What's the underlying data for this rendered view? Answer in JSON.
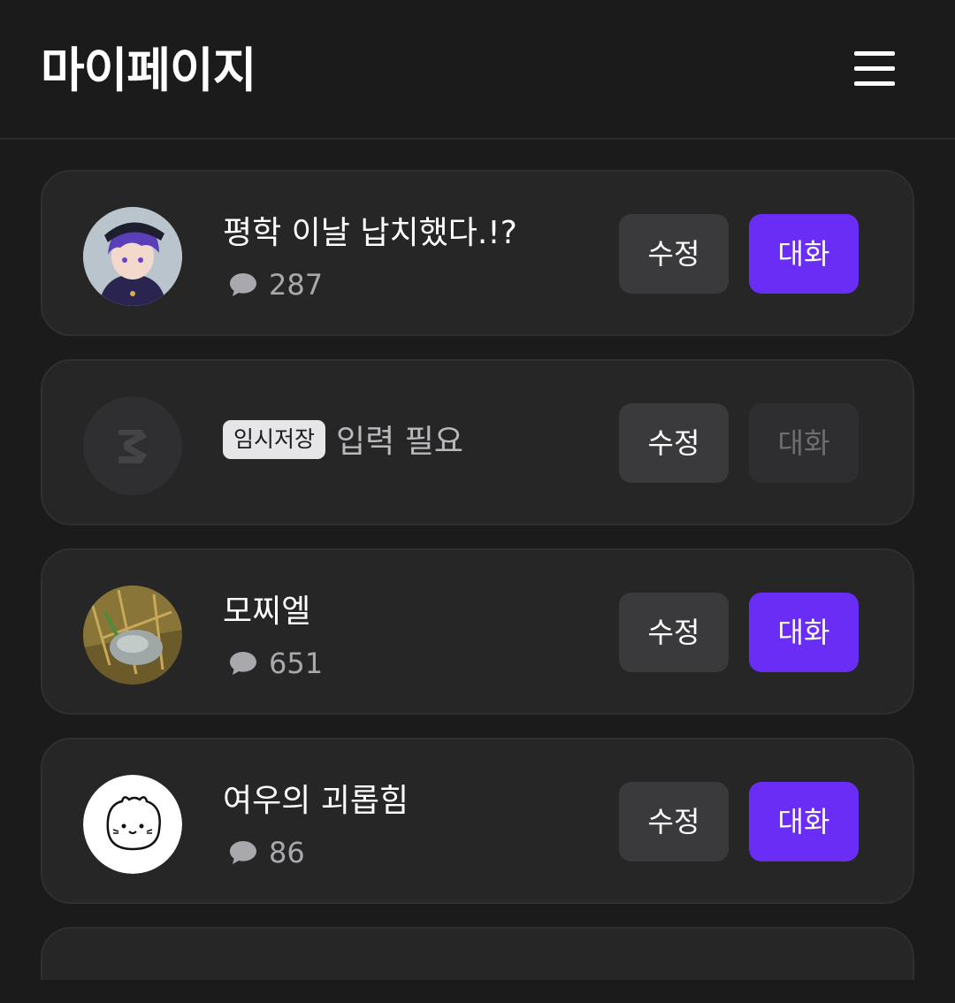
{
  "header": {
    "title": "마이페이지",
    "menu_icon": "hamburger-menu-icon"
  },
  "characters": [
    {
      "name": "평학 이날 납치했다.!?",
      "chat_count": "287",
      "edit_label": "수정",
      "chat_label": "대화",
      "chat_enabled": true
    },
    {
      "draft_badge": "임시저장",
      "name": "입력 필요",
      "edit_label": "수정",
      "chat_label": "대화",
      "chat_enabled": false
    },
    {
      "name": "모찌엘",
      "chat_count": "651",
      "edit_label": "수정",
      "chat_label": "대화",
      "chat_enabled": true
    },
    {
      "name": "여우의 괴롭힘",
      "chat_count": "86",
      "edit_label": "수정",
      "chat_label": "대화",
      "chat_enabled": true
    }
  ],
  "colors": {
    "accent": "#6a2df5",
    "background": "#1b1b1c",
    "card": "#262627",
    "secondary_button": "#3a3a3c"
  }
}
